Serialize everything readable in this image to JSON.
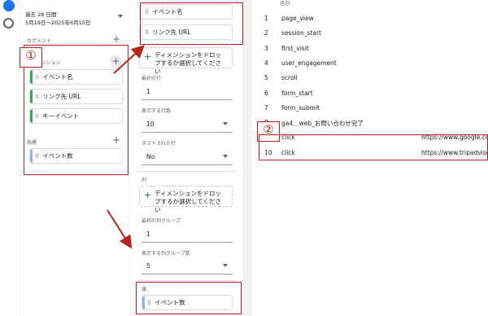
{
  "date_range": {
    "title": "過去 28 日間",
    "subtitle": "5月19日〜2025年6月15日"
  },
  "left_panel": {
    "segments_label": "セグメント",
    "dimensions_label": "ディメンション",
    "dimensions": [
      "イベント名",
      "リンク先 URL",
      "キーイベント"
    ],
    "metrics_label": "指標",
    "metrics": [
      "イベント数"
    ]
  },
  "mid_panel": {
    "rows_chips": [
      "イベント名",
      "リンク先 URL"
    ],
    "drop_text": "ディメンションをドロップするか選択してください",
    "first_row_label": "最初の行",
    "first_row_value": "1",
    "show_rows_label": "表示する行数",
    "show_rows_value": "10",
    "nested_rows_label": "ネストされた行",
    "nested_rows_value": "No",
    "columns_label": "列",
    "first_col_group_label": "最初の列グループ",
    "first_col_group_value": "1",
    "show_col_groups_label": "表示する列グループ数",
    "show_col_groups_value": "5",
    "values_label": "値",
    "values_chip": "イベント数"
  },
  "table": {
    "header": "合計",
    "rows": [
      {
        "num": "1",
        "name": "page_view",
        "url": ""
      },
      {
        "num": "2",
        "name": "session_start",
        "url": ""
      },
      {
        "num": "3",
        "name": "first_visit",
        "url": ""
      },
      {
        "num": "4",
        "name": "user_engagement",
        "url": ""
      },
      {
        "num": "5",
        "name": "scroll",
        "url": ""
      },
      {
        "num": "6",
        "name": "form_start",
        "url": ""
      },
      {
        "num": "7",
        "name": "form_submit",
        "url": ""
      },
      {
        "num": "8",
        "name": "ga4＿web_お問い合わせ完了",
        "url": ""
      },
      {
        "num": "",
        "name": "click",
        "url": "https://www.google.com."
      },
      {
        "num": "10",
        "name": "click",
        "url": "https://www.tripadvisor.c"
      }
    ]
  },
  "annotations": {
    "one": "①",
    "two": "②"
  },
  "colors": {
    "dimension_bar": "#34a853",
    "metric_bar": "#8ab4f8",
    "annotation_red": "#b3261e"
  }
}
